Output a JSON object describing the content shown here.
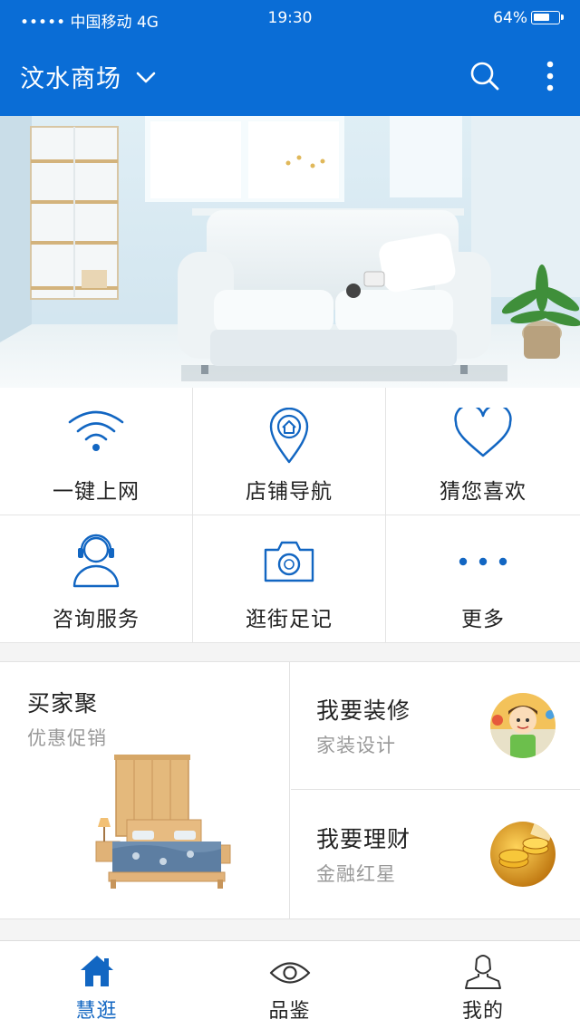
{
  "status_bar": {
    "carrier": "••••• 中国移动 4G",
    "time": "19:30",
    "battery": "64%"
  },
  "header": {
    "title": "汶水商场",
    "icons": [
      "chevron-down-icon",
      "search-icon",
      "more-vertical-icon"
    ]
  },
  "quick_menu": [
    {
      "label": "一键上网",
      "icon": "wifi-icon"
    },
    {
      "label": "店铺导航",
      "icon": "location-home-icon"
    },
    {
      "label": "猜您喜欢",
      "icon": "heart-icon"
    },
    {
      "label": "咨询服务",
      "icon": "headset-user-icon"
    },
    {
      "label": "逛街足记",
      "icon": "camera-icon"
    },
    {
      "label": "更多",
      "icon": "more-dots-icon"
    }
  ],
  "promo": {
    "main": {
      "title": "买家聚",
      "subtitle": "优惠促销"
    },
    "cards": [
      {
        "title": "我要装修",
        "subtitle": "家装设计"
      },
      {
        "title": "我要理财",
        "subtitle": "金融红星"
      }
    ]
  },
  "tab_bar": [
    {
      "label": "慧逛",
      "icon": "home-icon",
      "active": true
    },
    {
      "label": "品鉴",
      "icon": "eye-icon",
      "active": false
    },
    {
      "label": "我的",
      "icon": "user-icon",
      "active": false
    }
  ],
  "colors": {
    "primary": "#0a6dd6",
    "icon_blue": "#1266c2",
    "text": "#222222",
    "muted_text": "#999999",
    "divider": "#e4e4e4"
  }
}
